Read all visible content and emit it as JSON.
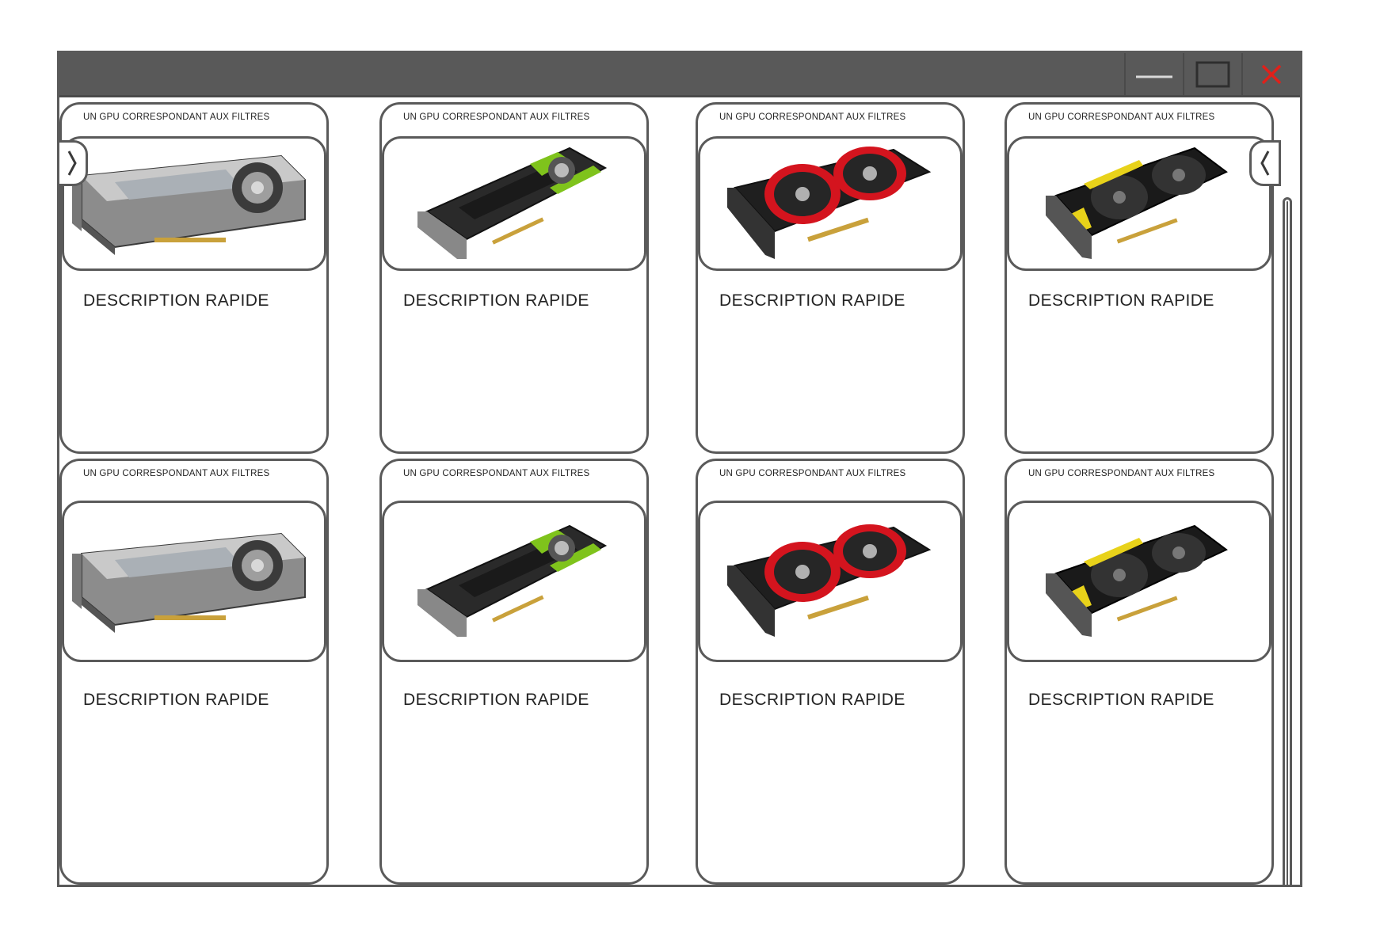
{
  "window": {
    "controls": {
      "minimize_icon": "minimize-icon",
      "maximize_icon": "maximize-icon",
      "close_icon": "close-icon",
      "close_color": "#e0201a"
    }
  },
  "navigation": {
    "left_icon": "chevron-right-icon",
    "right_icon": "chevron-left-icon"
  },
  "cards": [
    {
      "title": "UN GPU CORRESPONDANT AUX FILTRES",
      "description": "DESCRIPTION RAPIDE",
      "image": "gpu-silver-blower"
    },
    {
      "title": "UN GPU CORRESPONDANT AUX FILTRES",
      "description": "DESCRIPTION RAPIDE",
      "image": "gpu-green-quadro"
    },
    {
      "title": "UN GPU CORRESPONDANT AUX FILTRES",
      "description": "DESCRIPTION RAPIDE",
      "image": "gpu-red-dual-fan"
    },
    {
      "title": "UN GPU CORRESPONDANT AUX FILTRES",
      "description": "DESCRIPTION RAPIDE",
      "image": "gpu-yellow-dual-fan"
    },
    {
      "title": "UN GPU CORRESPONDANT AUX FILTRES",
      "description": "DESCRIPTION RAPIDE",
      "image": "gpu-silver-blower"
    },
    {
      "title": "UN GPU CORRESPONDANT AUX FILTRES",
      "description": "DESCRIPTION RAPIDE",
      "image": "gpu-green-quadro"
    },
    {
      "title": "UN GPU CORRESPONDANT AUX FILTRES",
      "description": "DESCRIPTION RAPIDE",
      "image": "gpu-red-dual-fan"
    },
    {
      "title": "UN GPU CORRESPONDANT AUX FILTRES",
      "description": "DESCRIPTION RAPIDE",
      "image": "gpu-yellow-dual-fan"
    }
  ],
  "colors": {
    "titlebar": "#595959",
    "border": "#5a5a5a",
    "accent_green": "#7fc31c",
    "accent_red": "#d4141e",
    "accent_yellow": "#e8d21a"
  }
}
